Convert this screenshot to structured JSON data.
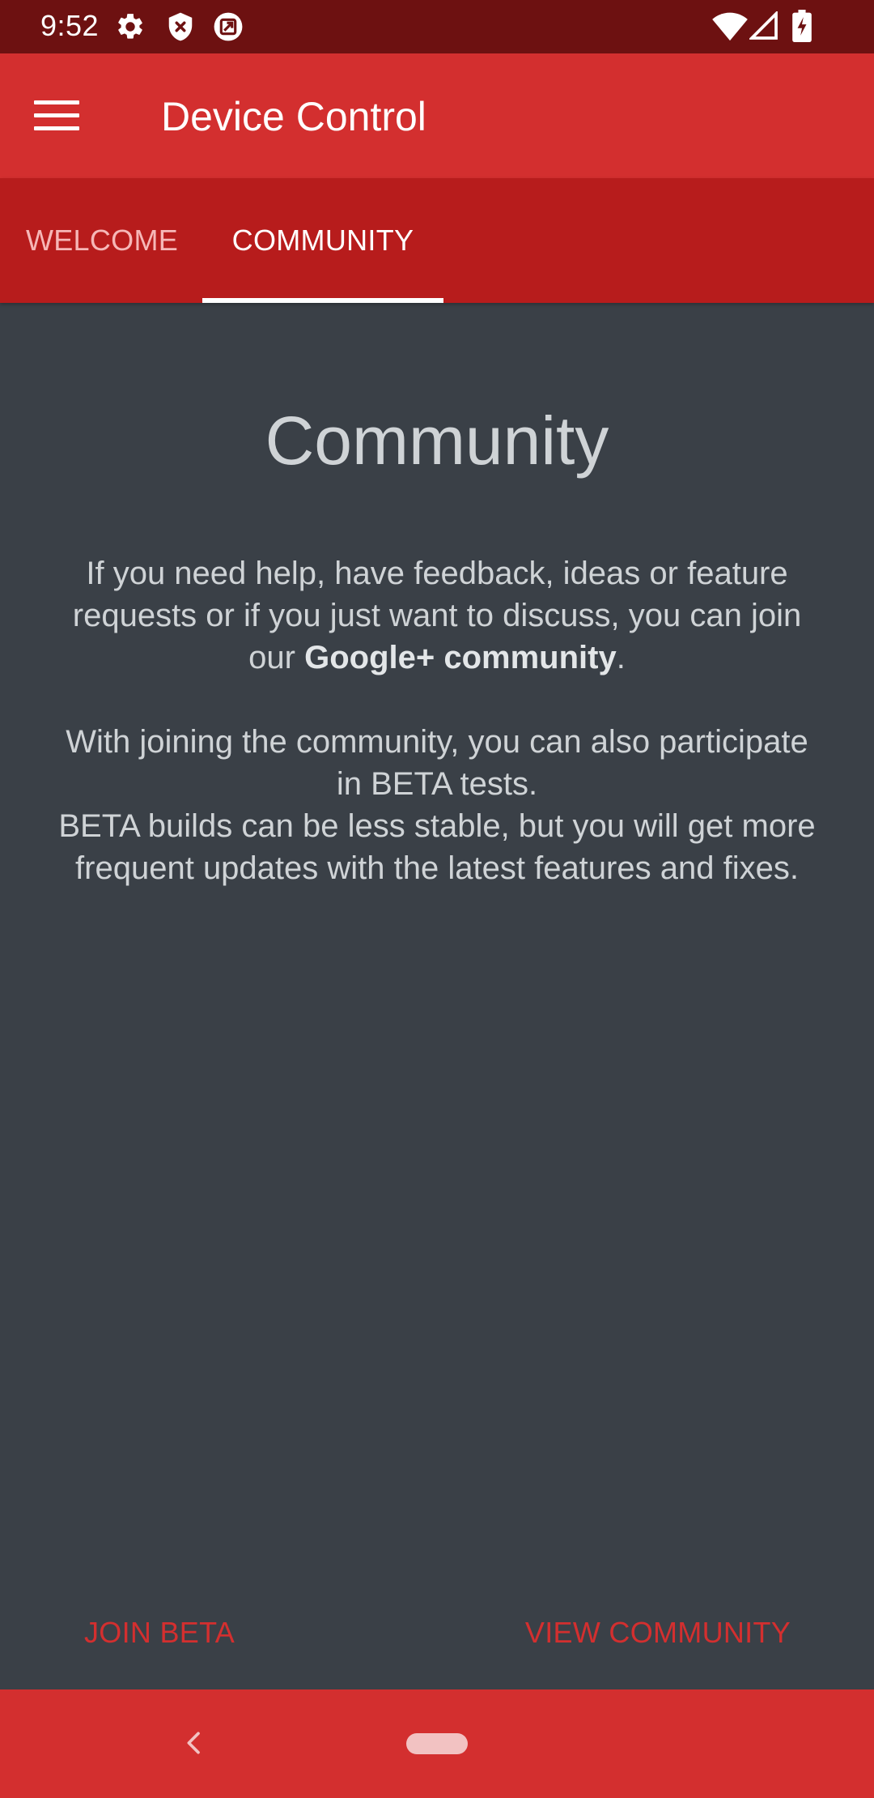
{
  "status_bar": {
    "time": "9:52",
    "icons": [
      "gear-icon",
      "shield-icon",
      "square-icon",
      "wifi-icon",
      "signal-icon",
      "battery-icon"
    ]
  },
  "toolbar": {
    "menu_icon": "hamburger-menu-icon",
    "title": "Device Control"
  },
  "tabs": [
    {
      "label": "WELCOME",
      "selected": false
    },
    {
      "label": "COMMUNITY",
      "selected": true
    }
  ],
  "community": {
    "heading": "Community",
    "intro_before": "If you need help, have feedback, ideas or feature requests or if you just want to discuss, you can join our ",
    "intro_link": "Google+ community",
    "intro_after": ".",
    "beta_text_1": "With joining the community, you can also participate in BETA tests.",
    "beta_text_2": "BETA builds can be less stable, but you will get more frequent updates with the latest features and fixes."
  },
  "actions": {
    "join_beta": "JOIN BETA",
    "view_community": "VIEW COMMUNITY"
  },
  "nav_bar": {
    "back_icon": "back-chevron-icon",
    "home_icon": "home-pill-icon"
  },
  "colors": {
    "status_bar": "#6d1111",
    "toolbar": "#d32f2f",
    "tab_bar": "#b71c1c",
    "background": "#3a4047",
    "accent": "#d32f2f",
    "text": "#cfd3d6"
  }
}
